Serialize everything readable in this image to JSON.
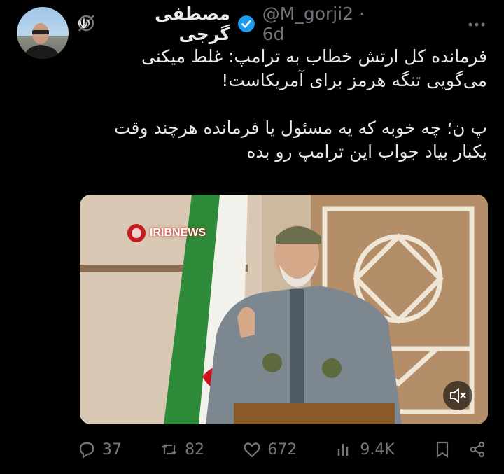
{
  "author": {
    "name": "مصطفی گرجی",
    "flag_emoji": "☫",
    "handle_time": "@M_gorji2 · 6d"
  },
  "tweet": {
    "text": "فرمانده کل ارتش خطاب به ترامپ: غلط میکنی\nمی‌گویی تنگه هرمز برای آمریکاست!\n\nپ ن؛ چه خوبه که یه مسئول یا فرمانده هرچند وقت\nیکبار بیاد جواب این ترامپ رو بده"
  },
  "media": {
    "watermark": "IRIBNEWS"
  },
  "actions": {
    "replies": "37",
    "reposts": "82",
    "likes": "672",
    "views": "9.4K"
  },
  "colors": {
    "background": "#000000",
    "text": "#e7e9ea",
    "muted": "#71767b",
    "verified": "#1d9bf0"
  },
  "icons": [
    "grok-icon",
    "more-icon",
    "verified-icon",
    "reply-icon",
    "repost-icon",
    "like-icon",
    "views-icon",
    "bookmark-icon",
    "share-icon",
    "mute-icon"
  ]
}
